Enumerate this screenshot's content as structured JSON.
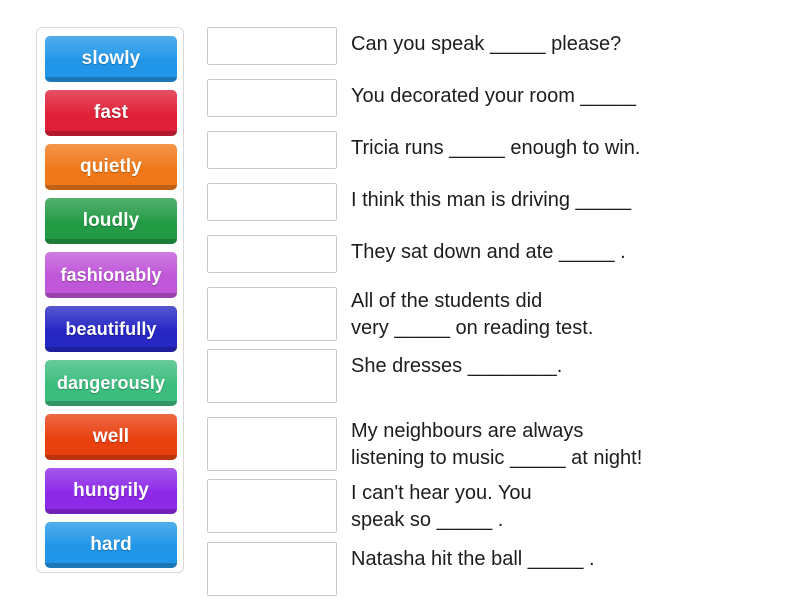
{
  "activity": {
    "type": "match-up",
    "title": "Adverbs match-up activity"
  },
  "tiles_panel": {
    "name": "word-bank",
    "tiles": [
      {
        "label": "slowly",
        "color": "#2196e8"
      },
      {
        "label": "fast",
        "color": "#e02038"
      },
      {
        "label": "quietly",
        "color": "#f07818"
      },
      {
        "label": "loudly",
        "color": "#239b45"
      },
      {
        "label": "fashionably",
        "color": "#c056d8"
      },
      {
        "label": "beautifully",
        "color": "#2727c4"
      },
      {
        "label": "dangerously",
        "color": "#3cbd7e"
      },
      {
        "label": "well",
        "color": "#e8400f"
      },
      {
        "label": "hungrily",
        "color": "#8c2ae8"
      },
      {
        "label": "hard",
        "color": "#2196e8"
      }
    ]
  },
  "rows": [
    {
      "answer": "",
      "sentence": "Can you speak _____ please?",
      "lines": 1
    },
    {
      "answer": "",
      "sentence": "You decorated your room _____",
      "lines": 1
    },
    {
      "answer": "",
      "sentence": "Tricia runs _____ enough to win.",
      "lines": 1
    },
    {
      "answer": "",
      "sentence": "I think this man is driving _____",
      "lines": 1
    },
    {
      "answer": "",
      "sentence": "They sat down and ate _____ .",
      "lines": 1
    },
    {
      "answer": "",
      "sentence": "All of the students did\nvery _____ on reading test.",
      "lines": 2
    },
    {
      "answer": "",
      "sentence": "She dresses ________.",
      "lines": 1
    },
    {
      "answer": "",
      "sentence": "My neighbours are always\nlistening to music _____ at night!",
      "lines": 2
    },
    {
      "answer": "",
      "sentence": "I can't hear you. You\nspeak so _____ .",
      "lines": 2
    },
    {
      "answer": "",
      "sentence": "Natasha hit the ball _____ .",
      "lines": 1
    }
  ]
}
